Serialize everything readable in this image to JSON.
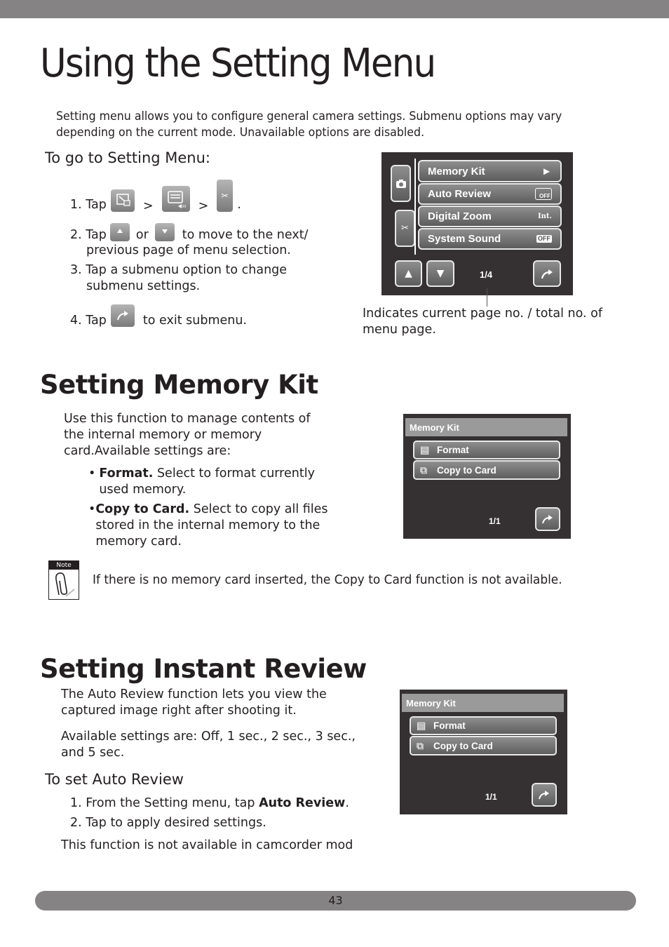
{
  "page": {
    "title": "Using the Setting Menu",
    "intro": "Setting menu allows you to configure general camera settings. Submenu options may vary depending on the current mode. Unavailable options are disabled.",
    "page_number": "43"
  },
  "goto_setting": {
    "heading": "To go to Setting Menu:",
    "step1": {
      "num": "1. Tap",
      "sep1": ">",
      "sep2": ">",
      "end": ".",
      "icons": [
        "mode-icon",
        "menu-icon",
        "setting-wrench-icon"
      ]
    },
    "step2": {
      "num": "2. Tap",
      "or": "or",
      "rest": "to move to the next/",
      "line2": "previous page of menu selection.",
      "icons": [
        "up-arrow-icon",
        "down-arrow-icon"
      ]
    },
    "step3": {
      "line1": "3. Tap a submenu option to change",
      "line2": "submenu settings."
    },
    "step4": {
      "num": "4. Tap",
      "rest": "to exit submenu.",
      "icons": [
        "exit-arrow-icon"
      ]
    }
  },
  "setting_screen": {
    "items": [
      {
        "label": "Memory Kit",
        "indicator": "►",
        "icon": "play-arrow-icon"
      },
      {
        "label": "Auto Review",
        "indicator": "OFF",
        "icon": "auto-review-off-icon"
      },
      {
        "label": "Digital Zoom",
        "indicator": "Int.",
        "icon": "digital-zoom-int-icon"
      },
      {
        "label": "System Sound",
        "indicator": "OFF",
        "icon": "sound-off-icon"
      }
    ],
    "side_tabs": [
      "camera-icon",
      "wrench-icon"
    ],
    "page_indicator": "1/4",
    "up": "▲",
    "down": "▼"
  },
  "callout": "Indicates current page no. / total no. of menu page.",
  "memory_kit": {
    "heading": "Setting Memory Kit",
    "intro": "Use this function to manage contents of the internal memory or memory card.Available settings are:",
    "bullets": [
      {
        "bold": "Format.",
        "text": " Select to format currently used memory."
      },
      {
        "bold": "Copy to Card.",
        "text": " Select to copy all files stored in the internal memory to the memory card."
      }
    ],
    "screen": {
      "header": "Memory Kit",
      "items": [
        {
          "label": "Format",
          "icon": "format-icon"
        },
        {
          "label": "Copy to Card",
          "icon": "copy-to-card-icon"
        }
      ],
      "page_indicator": "1/1"
    }
  },
  "note": {
    "label": "Note",
    "text": "If there is no memory card inserted, the Copy to Card function is not available."
  },
  "instant_review": {
    "heading": "Setting Instant Review",
    "para1": "The Auto Review function lets you view the captured image right after shooting it.",
    "para2": "Available settings are: Off, 1 sec., 2 sec., 3 sec., and 5 sec.",
    "subheading": "To set Auto Review",
    "step1_pre": "1. From the Setting menu, tap ",
    "step1_bold": "Auto Review",
    "step1_post": ".",
    "step2": "2. Tap to apply desired settings.",
    "footnote": "This function is not available in camcorder mod",
    "screen": {
      "header": "Memory Kit",
      "items": [
        {
          "label": "Format",
          "icon": "format-icon"
        },
        {
          "label": "Copy to Card",
          "icon": "copy-to-card-icon"
        }
      ],
      "page_indicator": "1/1"
    }
  }
}
